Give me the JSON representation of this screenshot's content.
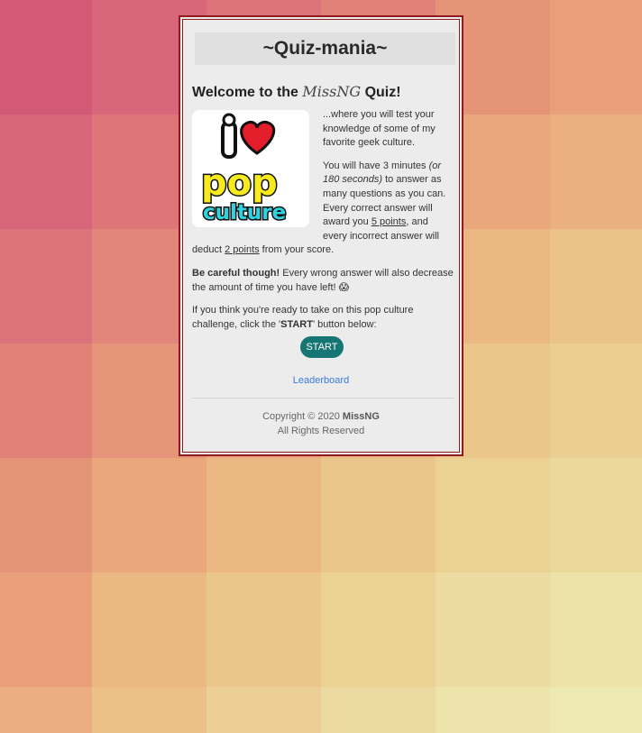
{
  "page": {
    "title": "~Quiz-mania~",
    "welcome_prefix": "Welcome to the",
    "welcome_name": "MissNG",
    "welcome_suffix": "Quiz!",
    "logo_text_top": "i",
    "logo_text_mid": "pop",
    "logo_text_bottom": "culture"
  },
  "intro": {
    "p1": "...where you will test your knowledge of some of my favorite geek culture.",
    "p2_a": "You will have 3 minutes ",
    "p2_italic": "(or 180 seconds)",
    "p2_b": " to answer as many questions as you can. Every correct answer will award you ",
    "p2_points_award": "5 points",
    "p2_c": ", and every incorrect answer will deduct ",
    "p2_points_deduct": "2 points",
    "p2_d": " from your score.",
    "p3_bold": "Be careful though!",
    "p3_rest": " Every wrong answer will also decrease the amount of time you have left! 😱",
    "p4_a": "If you think you're ready to take on this pop culture challenge, click the '",
    "p4_bold": "START",
    "p4_b": "' button below:"
  },
  "actions": {
    "start_label": "START",
    "leaderboard_label": "Leaderboard"
  },
  "footer": {
    "copyright_prefix": "Copyright © 2020 ",
    "copyright_name": "MissNG",
    "rights": "All Rights Reserved"
  },
  "colors": {
    "accent": "#157673",
    "link": "#3b7bd6",
    "border": "#8f1b1e",
    "background_tiles": [
      [
        "#d25a74",
        "#d8667a",
        "#dc737a",
        "#e08277",
        "#e69477",
        "#e99f79"
      ],
      [
        "#d8667a",
        "#de7579",
        "#e2857a",
        "#e6957a",
        "#eaa77c",
        "#eab07f"
      ],
      [
        "#dc737a",
        "#e2857a",
        "#e6957a",
        "#eaa87e",
        "#ebb883",
        "#ebc389"
      ],
      [
        "#e08277",
        "#e6957a",
        "#eaa87e",
        "#ebb883",
        "#ebc68b",
        "#ebcf92"
      ],
      [
        "#e69477",
        "#eaa77c",
        "#ebb883",
        "#ebc68b",
        "#ebd193",
        "#ebd99b"
      ],
      [
        "#e9a07a",
        "#ebb883",
        "#ebc68b",
        "#ebd193",
        "#ebdba0",
        "#ece3a8"
      ],
      [
        "#ebae82",
        "#ebc189",
        "#ebcf95",
        "#ebdaa0",
        "#ece4ab",
        "#ece9b3"
      ]
    ]
  }
}
